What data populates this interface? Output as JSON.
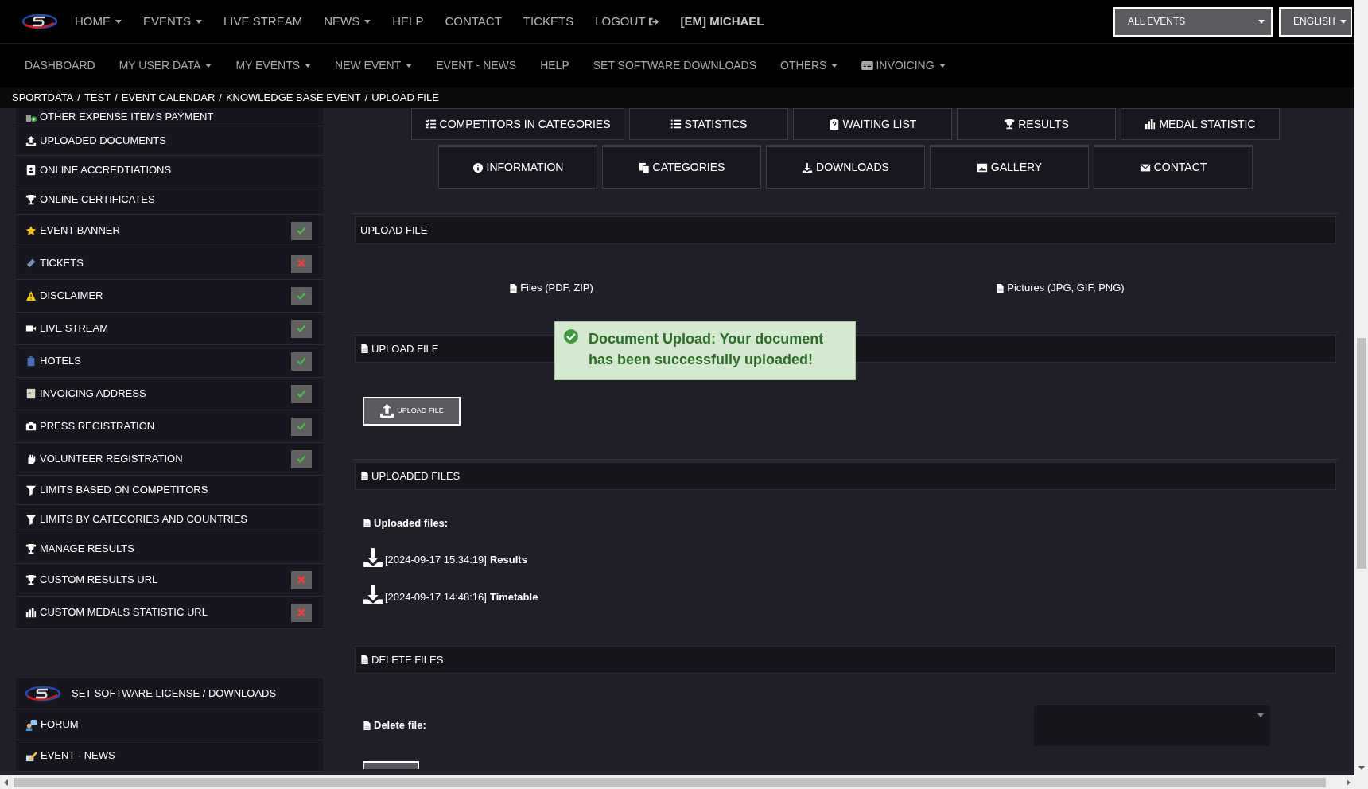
{
  "top_nav": {
    "items": [
      {
        "label": "HOME",
        "kind": "dropdown"
      },
      {
        "label": "EVENTS",
        "kind": "dropdown"
      },
      {
        "label": "LIVE STREAM",
        "kind": "link"
      },
      {
        "label": "NEWS",
        "kind": "dropdown"
      },
      {
        "label": "HELP",
        "kind": "link"
      },
      {
        "label": "CONTACT",
        "kind": "link"
      },
      {
        "label": "TICKETS",
        "kind": "link"
      },
      {
        "label": "LOGOUT",
        "kind": "logout"
      }
    ],
    "user": "[EM] MICHAEL",
    "event_select": "ALL EVENTS",
    "language_select": "ENGLISH"
  },
  "sub_nav": {
    "items": [
      {
        "label": "DASHBOARD",
        "kind": "link"
      },
      {
        "label": "MY USER DATA",
        "kind": "dropdown"
      },
      {
        "label": "MY EVENTS",
        "kind": "dropdown"
      },
      {
        "label": "NEW EVENT",
        "kind": "dropdown"
      },
      {
        "label": "EVENT - NEWS",
        "kind": "link"
      },
      {
        "label": "HELP",
        "kind": "link"
      },
      {
        "label": "SET SOFTWARE DOWNLOADS",
        "kind": "link"
      },
      {
        "label": "OTHERS",
        "kind": "dropdown"
      },
      {
        "label": "INVOICING",
        "kind": "dropdown"
      }
    ]
  },
  "breadcrumb": [
    "SPORTDATA",
    "TEST",
    "EVENT CALENDAR",
    "KNOWLEDGE BASE EVENT",
    "UPLOAD FILE"
  ],
  "breadcrumb_separator": "/",
  "sidebar": {
    "groups": [
      {
        "items": [
          {
            "label": "OTHER EXPENSE ITEMS PAYMENT"
          },
          {
            "label": "UPLOADED DOCUMENTS"
          },
          {
            "label": "ONLINE ACCREDTIATIONS"
          },
          {
            "label": "ONLINE CERTIFICATES"
          },
          {
            "label": "EVENT BANNER",
            "done": true
          },
          {
            "label": "TICKETS",
            "done": false
          },
          {
            "label": "DISCLAIMER",
            "done": true
          },
          {
            "label": "LIVE STREAM",
            "done": true
          },
          {
            "label": "HOTELS",
            "done": true
          },
          {
            "label": "INVOICING ADDRESS",
            "done": true
          },
          {
            "label": "PRESS REGISTRATION",
            "done": true
          },
          {
            "label": "VOLUNTEER REGISTRATION",
            "done": true
          },
          {
            "label": "LIMITS BASED ON COMPETITORS"
          },
          {
            "label": "LIMITS BY CATEGORIES AND COUNTRIES"
          },
          {
            "label": "MANAGE RESULTS"
          },
          {
            "label": "CUSTOM RESULTS URL",
            "done": false
          },
          {
            "label": "CUSTOM MEDALS STATISTIC URL",
            "done": false
          }
        ]
      },
      {
        "items": [
          {
            "label": "SET SOFTWARE LICENSE / DOWNLOADS"
          },
          {
            "label": "FORUM"
          },
          {
            "label": "EVENT - NEWS"
          }
        ]
      }
    ]
  },
  "event_tabs": [
    [
      "COMPETITORS IN CATEGORIES",
      "STATISTICS",
      "WAITING LIST",
      "RESULTS",
      "MEDAL STATISTIC"
    ],
    [
      "INFORMATION",
      "CATEGORIES",
      "DOWNLOADS",
      "GALLERY",
      "CONTACT"
    ]
  ],
  "upload_section": {
    "title": "UPLOAD FILE",
    "file_types": [
      "Files (PDF, ZIP)",
      "Pictures (JPG, GIF, PNG)"
    ]
  },
  "upload_file": {
    "title": "UPLOAD FILE",
    "button": "UPLOAD FILE"
  },
  "uploaded_files": {
    "title": "UPLOADED FILES",
    "label": "Uploaded files:",
    "files": [
      {
        "timestamp": "[2024-09-17 15:34:19]",
        "name": "Results"
      },
      {
        "timestamp": "[2024-09-17 14:48:16]",
        "name": "Timetable"
      }
    ]
  },
  "delete_files": {
    "title": "DELETE FILES",
    "label": "Delete file:"
  },
  "alert": {
    "text": "Document Upload: Your document has been successfully uploaded!"
  }
}
